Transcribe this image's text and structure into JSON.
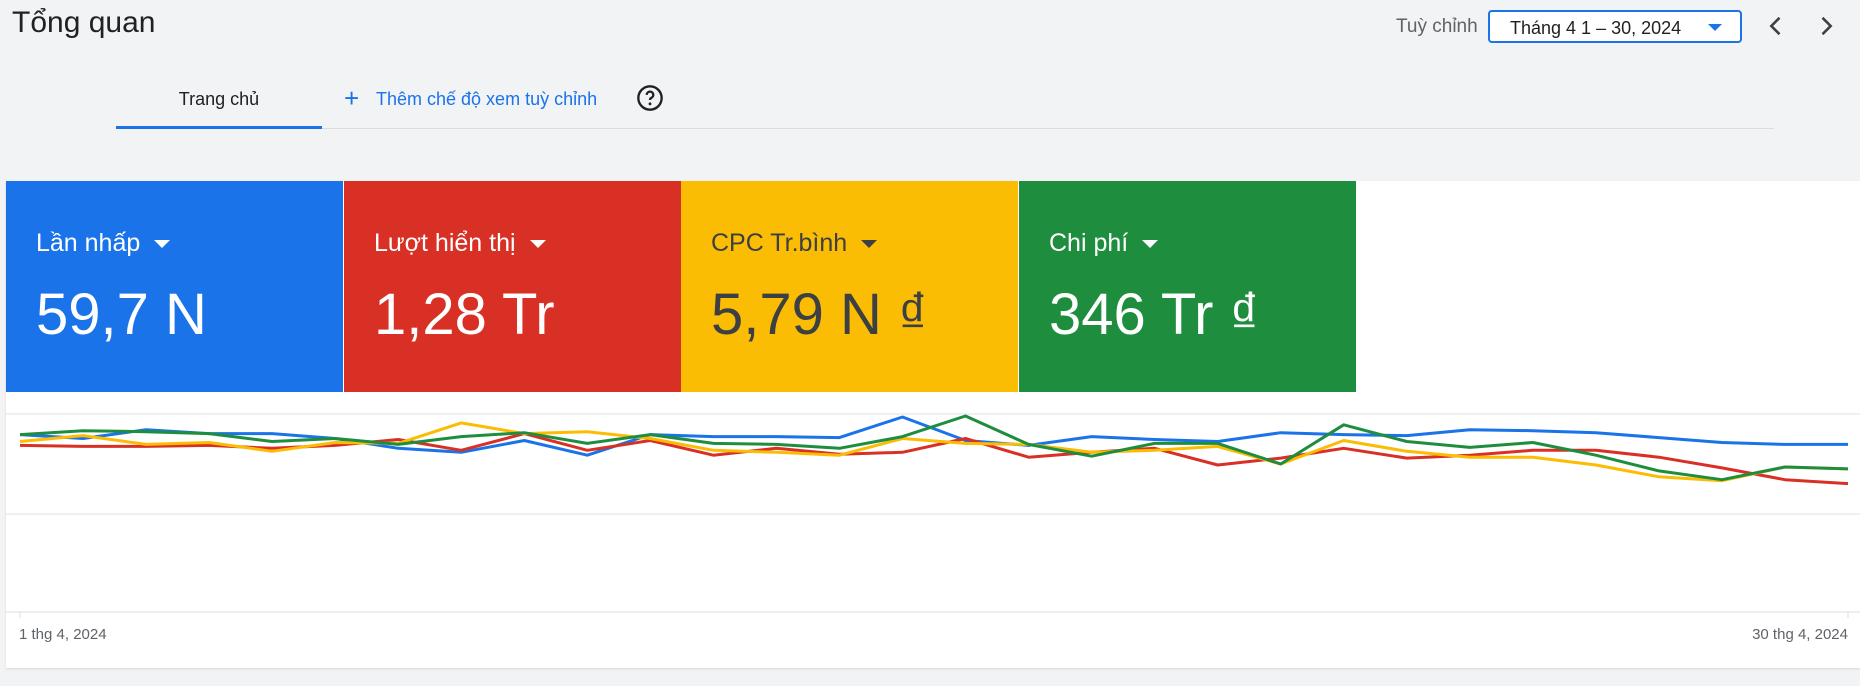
{
  "header": {
    "title": "Tổng quan",
    "range_label": "Tuỳ chỉnh",
    "date_range": "Tháng 4 1 – 30, 2024"
  },
  "tabs": {
    "home": "Trang chủ",
    "add_view": "Thêm chế độ xem tuỳ chỉnh"
  },
  "metrics": [
    {
      "label": "Lần nhấp",
      "value": "59,7 N",
      "color": "#1a73e8"
    },
    {
      "label": "Lượt hiển thị",
      "value": "1,28 Tr",
      "color": "#d93025"
    },
    {
      "label": "CPC Tr.bình",
      "value": "5,79 N ₫",
      "color": "#fbbc04"
    },
    {
      "label": "Chi phí",
      "value": "346 Tr ₫",
      "color": "#1e8e3e"
    }
  ],
  "chart_data": {
    "type": "line",
    "x_start_label": "1 thg 4, 2024",
    "x_end_label": "30 thg 4, 2024",
    "x": [
      1,
      2,
      3,
      4,
      5,
      6,
      7,
      8,
      9,
      10,
      11,
      12,
      13,
      14,
      15,
      16,
      17,
      18,
      19,
      20,
      21,
      22,
      23,
      24,
      25,
      26,
      27,
      28,
      29,
      30
    ],
    "ylim": [
      0,
      1
    ],
    "grid": true,
    "series": [
      {
        "name": "Lần nhấp",
        "color": "#1a73e8",
        "values": [
          0.81,
          0.77,
          0.86,
          0.82,
          0.82,
          0.77,
          0.67,
          0.63,
          0.75,
          0.6,
          0.81,
          0.79,
          0.79,
          0.78,
          0.99,
          0.75,
          0.7,
          0.79,
          0.76,
          0.74,
          0.83,
          0.81,
          0.8,
          0.86,
          0.85,
          0.83,
          0.78,
          0.73,
          0.71,
          0.71
        ]
      },
      {
        "name": "Lượt hiển thị",
        "color": "#d93025",
        "values": [
          0.7,
          0.69,
          0.69,
          0.7,
          0.67,
          0.7,
          0.76,
          0.65,
          0.82,
          0.65,
          0.75,
          0.6,
          0.67,
          0.61,
          0.63,
          0.77,
          0.58,
          0.63,
          0.67,
          0.5,
          0.57,
          0.67,
          0.57,
          0.6,
          0.65,
          0.65,
          0.58,
          0.47,
          0.35,
          0.31
        ]
      },
      {
        "name": "CPC Tr.bình",
        "color": "#fbbc04",
        "values": [
          0.74,
          0.8,
          0.71,
          0.73,
          0.64,
          0.73,
          0.72,
          0.93,
          0.82,
          0.84,
          0.77,
          0.65,
          0.63,
          0.6,
          0.77,
          0.72,
          0.71,
          0.63,
          0.65,
          0.69,
          0.51,
          0.75,
          0.64,
          0.58,
          0.58,
          0.5,
          0.38,
          0.34,
          0.48,
          0.46
        ]
      },
      {
        "name": "Chi phí",
        "color": "#1e8e3e",
        "values": [
          0.81,
          0.85,
          0.84,
          0.82,
          0.74,
          0.77,
          0.71,
          0.79,
          0.83,
          0.72,
          0.81,
          0.72,
          0.71,
          0.67,
          0.79,
          1.0,
          0.71,
          0.59,
          0.72,
          0.72,
          0.51,
          0.91,
          0.74,
          0.68,
          0.73,
          0.6,
          0.44,
          0.35,
          0.48,
          0.46
        ]
      }
    ]
  }
}
